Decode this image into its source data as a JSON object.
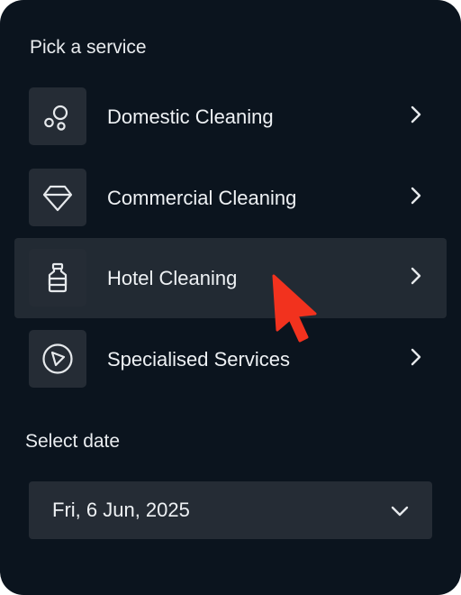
{
  "services": {
    "title": "Pick a service",
    "items": [
      {
        "label": "Domestic Cleaning",
        "icon": "bubbles-icon"
      },
      {
        "label": "Commercial Cleaning",
        "icon": "gem-icon"
      },
      {
        "label": "Hotel Cleaning",
        "icon": "bottle-icon"
      },
      {
        "label": "Specialised Services",
        "icon": "play-circle-icon"
      }
    ],
    "selected_index": 2
  },
  "date": {
    "title": "Select date",
    "value": "Fri, 6 Jun, 2025"
  },
  "colors": {
    "background": "#0b141e",
    "row_highlight": "#222a33",
    "tile": "#252c35",
    "text": "#eef1f4",
    "cursor": "#f2321e"
  }
}
